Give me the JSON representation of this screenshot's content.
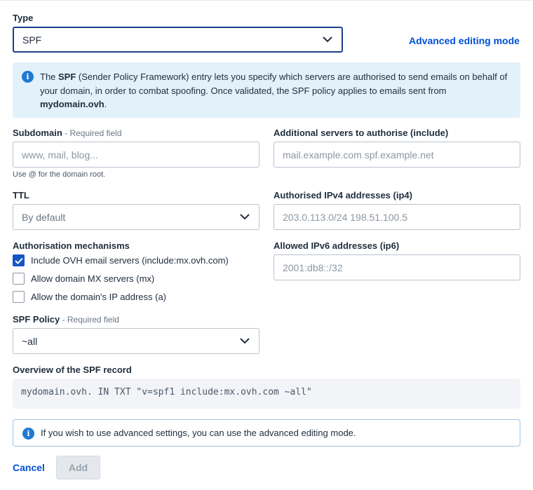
{
  "type_field": {
    "label": "Type",
    "value": "SPF"
  },
  "advanced_link": "Advanced editing mode",
  "info": {
    "prefix": "The ",
    "spf_bold": "SPF",
    "middle": " (Sender Policy Framework) entry lets you specify which servers are authorised to send emails on behalf of your domain, in order to combat spoofing. Once validated, the SPF policy applies to emails sent from ",
    "domain_bold": "mydomain.ovh",
    "suffix": "."
  },
  "subdomain": {
    "label": "Subdomain",
    "required": " - Required field",
    "placeholder": "www, mail, blog...",
    "hint": "Use @ for the domain root."
  },
  "include": {
    "label": "Additional servers to authorise (include)",
    "placeholder": "mail.example.com spf.example.net"
  },
  "ttl": {
    "label": "TTL",
    "value": "By default"
  },
  "ip4": {
    "label": "Authorised IPv4 addresses (ip4)",
    "placeholder": "203.0.113.0/24 198.51.100.5"
  },
  "mechanisms": {
    "label": "Authorisation mechanisms",
    "items": [
      {
        "label": "Include OVH email servers (include:mx.ovh.com)",
        "checked": true
      },
      {
        "label": "Allow domain MX servers (mx)",
        "checked": false
      },
      {
        "label": "Allow the domain's IP address (a)",
        "checked": false
      }
    ]
  },
  "ip6": {
    "label": "Allowed IPv6 addresses (ip6)",
    "placeholder": "2001:db8::/32"
  },
  "policy": {
    "label": "SPF Policy",
    "required": " - Required field",
    "value": "~all"
  },
  "overview": {
    "label": "Overview of the SPF record",
    "record": "mydomain.ovh. IN TXT \"v=spf1 include:mx.ovh.com ~all\""
  },
  "note": "If you wish to use advanced settings, you can use the advanced editing mode.",
  "actions": {
    "cancel": "Cancel",
    "add": "Add"
  },
  "colors": {
    "accent": "#0050d7",
    "info_bg": "#e3f1fa",
    "info_icon": "#1f7ad0",
    "checkbox": "#1356c4"
  }
}
